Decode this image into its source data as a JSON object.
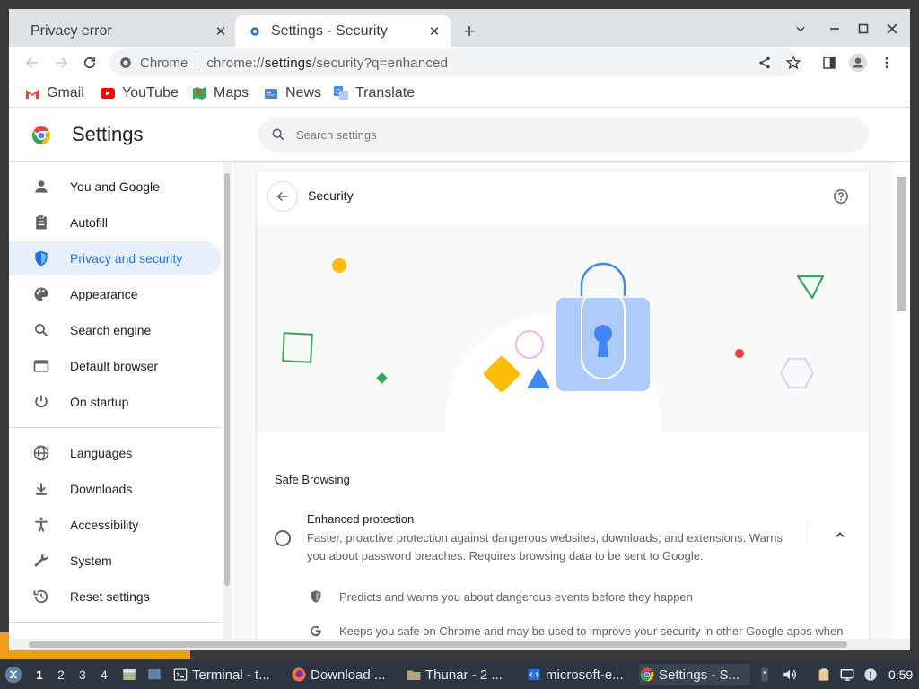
{
  "browser": {
    "tabs": [
      {
        "title": "Privacy error",
        "active": false
      },
      {
        "title": "Settings - Security",
        "active": true
      }
    ],
    "omnibox": {
      "chip": "Chrome",
      "url_scheme": "chrome://",
      "url_host": "settings",
      "url_path": "/security?q=enhanced"
    },
    "bookmarks": [
      "Gmail",
      "YouTube",
      "Maps",
      "News",
      "Translate"
    ]
  },
  "settings": {
    "title": "Settings",
    "search_placeholder": "Search settings",
    "sidebar": [
      {
        "label": "You and Google",
        "icon": "person-icon"
      },
      {
        "label": "Autofill",
        "icon": "clipboard-icon"
      },
      {
        "label": "Privacy and security",
        "icon": "shield-icon",
        "selected": true
      },
      {
        "label": "Appearance",
        "icon": "palette-icon"
      },
      {
        "label": "Search engine",
        "icon": "search-icon"
      },
      {
        "label": "Default browser",
        "icon": "browser-icon"
      },
      {
        "label": "On startup",
        "icon": "power-icon"
      },
      {
        "label": "Languages",
        "icon": "globe-icon"
      },
      {
        "label": "Downloads",
        "icon": "download-icon"
      },
      {
        "label": "Accessibility",
        "icon": "accessibility-icon"
      },
      {
        "label": "System",
        "icon": "wrench-icon"
      },
      {
        "label": "Reset settings",
        "icon": "history-icon"
      }
    ],
    "page_title": "Security",
    "section_label": "Safe Browsing",
    "option": {
      "title": "Enhanced protection",
      "description": "Faster, proactive protection against dangerous websites, downloads, and extensions. Warns you about password breaches. Requires browsing data to be sent to Google.",
      "bullets": [
        "Predicts and warns you about dangerous events before they happen",
        "Keeps you safe on Chrome and may be used to improve your security in other Google apps when"
      ]
    }
  },
  "taskbar": {
    "workspaces": [
      "1",
      "2",
      "3",
      "4"
    ],
    "tasks": [
      "Terminal - t...",
      "Download ...",
      "Thunar - 2 ...",
      "microsoft-e...",
      "Settings - S..."
    ],
    "clock": "0:59"
  },
  "colors": {
    "accent": "#1a73e8",
    "selected_bg": "#e8f0fe",
    "taskbar": "#2e3440"
  }
}
